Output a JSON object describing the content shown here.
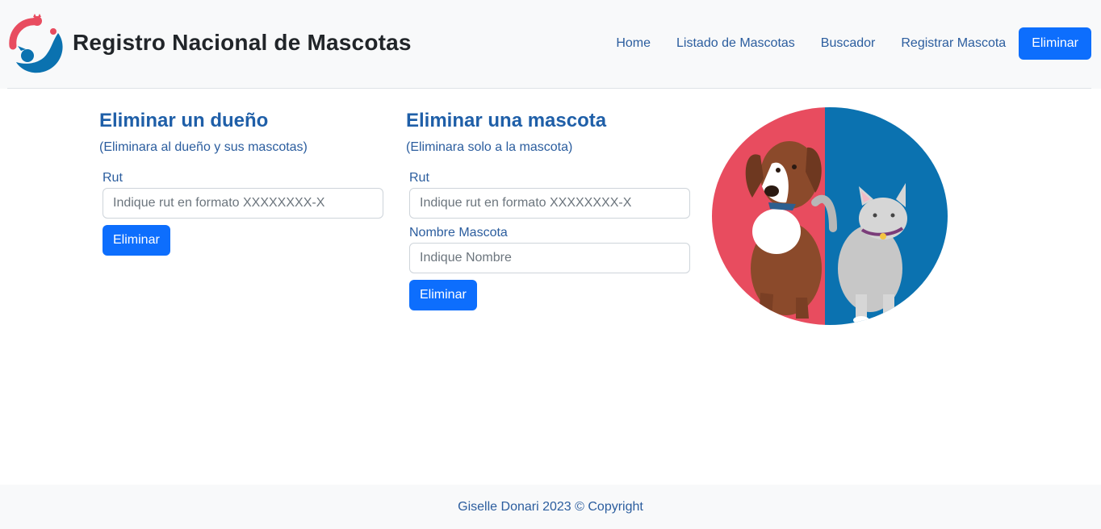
{
  "brand": {
    "title": "Registro Nacional de Mascotas",
    "logo_icon": "pet-logo-icon"
  },
  "nav": {
    "items": [
      {
        "label": "Home"
      },
      {
        "label": "Listado de Mascotas"
      },
      {
        "label": "Buscador"
      },
      {
        "label": "Registrar Mascota"
      }
    ],
    "active_button": "Eliminar"
  },
  "owner_form": {
    "title": "Eliminar un dueño",
    "subtitle": "(Eliminara al dueño y sus mascotas)",
    "rut_label": "Rut",
    "rut_placeholder": "Indique rut en formato XXXXXXXX-X",
    "submit": "Eliminar"
  },
  "pet_form": {
    "title": "Eliminar una mascota",
    "subtitle": "(Eliminara solo a la mascota)",
    "rut_label": "Rut",
    "rut_placeholder": "Indique rut en formato XXXXXXXX-X",
    "name_label": "Nombre Mascota",
    "name_placeholder": "Indique Nombre",
    "submit": "Eliminar"
  },
  "footer": {
    "text": "Giselle Donari 2023 © Copyright"
  },
  "colors": {
    "primary": "#0d6efd",
    "heading": "#1f5fa8",
    "hero_red": "#e84c5f",
    "hero_blue": "#0b72b0"
  }
}
